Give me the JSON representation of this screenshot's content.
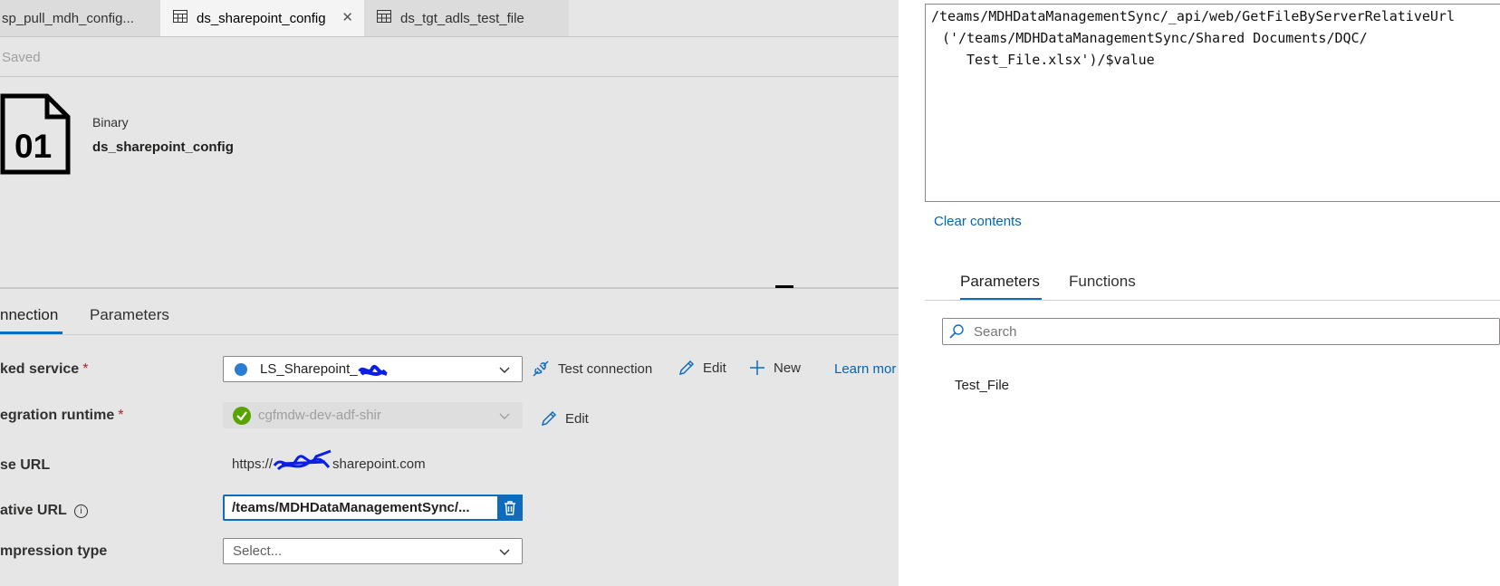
{
  "tabs": [
    {
      "label": "sp_pull_mdh_config..."
    },
    {
      "label": "ds_sharepoint_config",
      "close": "✕"
    },
    {
      "label": "ds_tgt_adls_test_file"
    }
  ],
  "status": "Saved",
  "dataset": {
    "icon_text": "01",
    "type": "Binary",
    "name": "ds_sharepoint_config"
  },
  "section_tabs": [
    "nnection",
    "Parameters"
  ],
  "form": {
    "linked_service": {
      "label": "ked service",
      "value": "LS_Sharepoint_"
    },
    "integration_runtime": {
      "label": "egration runtime",
      "value": "cgfmdw-dev-adf-shir"
    },
    "base_url": {
      "label": "se URL",
      "value_prefix": "https://",
      "value_suffix": "sharepoint.com"
    },
    "relative_url": {
      "label": "ative URL",
      "value": "/teams/MDHDataManagementSync/..."
    },
    "compression": {
      "label": "mpression type",
      "placeholder": "Select..."
    }
  },
  "actions": {
    "test_connection": "Test connection",
    "edit": "Edit",
    "new": "New",
    "learn_more": "Learn mor",
    "edit_ir": "Edit"
  },
  "required_mark": "*",
  "info_icon_glyph": "i",
  "expression": {
    "line1": "/teams/MDHDataManagementSync/_api/web/GetFileByServerRelativeUrl",
    "line2": "('/teams/MDHDataManagementSync/Shared Documents/DQC/",
    "line3": "Test_File.xlsx')/$value"
  },
  "clear_contents": "Clear contents",
  "panel_tabs": {
    "parameters": "Parameters",
    "functions": "Functions"
  },
  "search": {
    "placeholder": "Search"
  },
  "param_list": [
    "Test_File"
  ],
  "colors": {
    "accent": "#0f6cbd",
    "link": "#0066b8",
    "success": "#57a300",
    "scribble": "#0a1ee6"
  }
}
